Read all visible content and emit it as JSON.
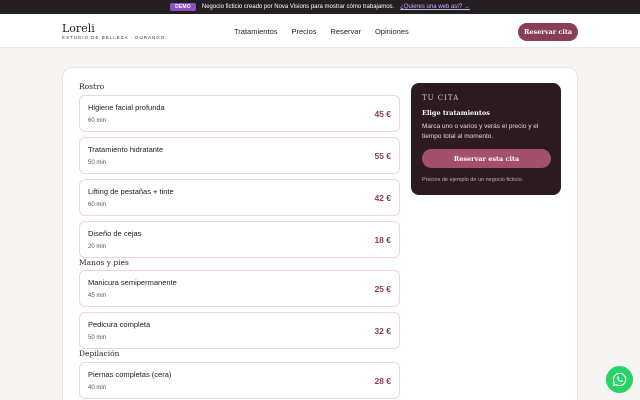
{
  "demo": {
    "badge": "DEMO",
    "text": "Negocio ficticio creado por Nova Visions para mostrar cómo trabajamos.",
    "link": "¿Quieres una web así? →"
  },
  "brand": {
    "name": "Loreli",
    "subtitle": "ESTUDIO DE BELLEZA · DURANGO"
  },
  "nav": {
    "items": [
      "Tratamientos",
      "Precios",
      "Reservar",
      "Opiniones"
    ],
    "cta": "Reservar cita"
  },
  "sections": [
    {
      "title": "Rostro"
    },
    {
      "title": "Manos y pies"
    },
    {
      "title": "Depilación"
    }
  ],
  "services": [
    {
      "name": "Higiene facial profunda",
      "duration": "60 min",
      "price": "45 €"
    },
    {
      "name": "Tratamiento hidratante",
      "duration": "50 min",
      "price": "55 €"
    },
    {
      "name": "Lifting de pestañas + tinte",
      "duration": "60 min",
      "price": "42 €"
    },
    {
      "name": "Diseño de cejas",
      "duration": "20 min",
      "price": "18 €"
    },
    {
      "name": "Manicura semipermanente",
      "duration": "45 min",
      "price": "25 €"
    },
    {
      "name": "Pedicura completa",
      "duration": "50 min",
      "price": "32 €"
    },
    {
      "name": "Piernas completas (cera)",
      "duration": "40 min",
      "price": "28 €"
    }
  ],
  "sidebar": {
    "heading": "TU CITA",
    "subheading": "Elige tratamientos",
    "description": "Marca uno o varios y verás el precio y el tiempo total al momento.",
    "button": "Reservar esta cita",
    "note": "Precios de ejemplo de un negocio ficticio."
  },
  "icons": {
    "whatsapp": "whatsapp-icon"
  },
  "colors": {
    "accent": "#8a3e55",
    "sidebar_bg": "#2c1a21",
    "whatsapp": "#25d366"
  }
}
